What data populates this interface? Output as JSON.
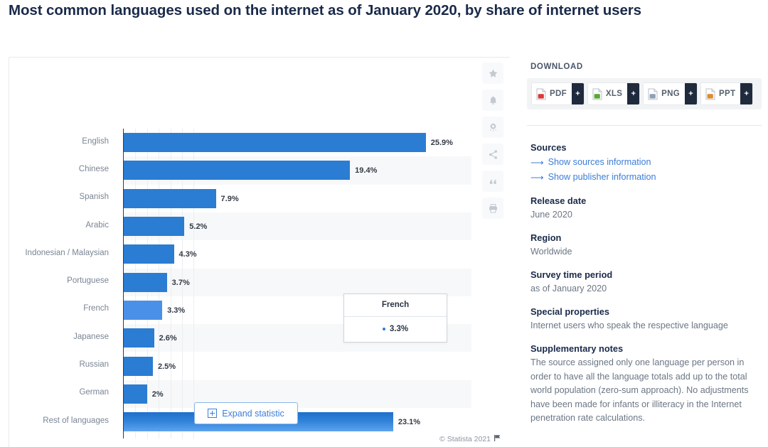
{
  "page_title": "Most common languages used on the internet as of January 2020, by share of internet users",
  "chart_data": {
    "type": "bar",
    "orientation": "horizontal",
    "title": "Most common languages used on the internet as of January 2020, by share of internet users",
    "xlabel": "",
    "ylabel": "",
    "xlim": [
      0,
      30
    ],
    "grid": "vertical",
    "gridline_step": 5,
    "legend": "none",
    "unit": "%",
    "categories": [
      "English",
      "Chinese",
      "Spanish",
      "Arabic",
      "Indonesian / Malaysian",
      "Portuguese",
      "French",
      "Japanese",
      "Russian",
      "German",
      "Rest of languages"
    ],
    "values": [
      25.9,
      19.4,
      7.9,
      5.2,
      4.3,
      3.7,
      3.3,
      2.6,
      2.5,
      2.0,
      23.1
    ],
    "value_labels": [
      "25.9%",
      "19.4%",
      "7.9%",
      "5.2%",
      "4.3%",
      "3.7%",
      "3.3%",
      "2.6%",
      "2.5%",
      "2%",
      "23.1%"
    ],
    "highlighted_category": "French",
    "bar_color": "#2b7cd3",
    "highlight_color": "#4a90e8",
    "rest_gradient": true
  },
  "tooltip": {
    "header": "French",
    "value": "3.3%",
    "dot_color": "#2b7cd3"
  },
  "chart_toolbar": {
    "items": [
      {
        "name": "star-icon",
        "title": "Favorite"
      },
      {
        "name": "bell-icon",
        "title": "Notify"
      },
      {
        "name": "gear-icon",
        "title": "Settings"
      },
      {
        "name": "share-icon",
        "title": "Share"
      },
      {
        "name": "quote-icon",
        "title": "Cite"
      },
      {
        "name": "printer-icon",
        "title": "Print"
      }
    ]
  },
  "expand_button": {
    "label": "Expand statistic",
    "icon": "expand-plus-icon"
  },
  "footer": {
    "credit": "© Statista 2021",
    "flag_icon": "flag-icon"
  },
  "sidebar": {
    "download": {
      "heading": "DOWNLOAD",
      "buttons": [
        {
          "label": "PDF",
          "plus": "+",
          "color": "#d93a3a"
        },
        {
          "label": "XLS",
          "plus": "+",
          "color": "#5aa832"
        },
        {
          "label": "PNG",
          "plus": "+",
          "color": "#8fa0b5"
        },
        {
          "label": "PPT",
          "plus": "+",
          "color": "#e08a2e"
        }
      ]
    },
    "meta": {
      "sources_heading": "Sources",
      "link_sources": "Show sources information",
      "link_publisher": "Show publisher information",
      "release_date_heading": "Release date",
      "release_date_value": "June 2020",
      "region_heading": "Region",
      "region_value": "Worldwide",
      "survey_heading": "Survey time period",
      "survey_value": "as of January 2020",
      "special_heading": "Special properties",
      "special_value": "Internet users who speak the respective language",
      "notes_heading": "Supplementary notes",
      "notes_value": "The source assigned only one language per person in order to have all the language totals add up to the total world population (zero-sum approach). No adjustments have been made for infants or illiteracy in the Internet penetration rate calculations."
    }
  }
}
